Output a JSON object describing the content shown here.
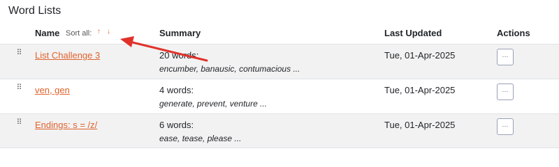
{
  "page": {
    "title": "Word Lists"
  },
  "header": {
    "name": "Name",
    "sort_all": "Sort all:",
    "sort_up": "↑",
    "sort_down": "↓",
    "summary": "Summary",
    "last_updated": "Last Updated",
    "actions": "Actions"
  },
  "rows": [
    {
      "name": "List Challenge 3",
      "count": "20 words:",
      "words": "encumber, banausic, contumacious ...",
      "updated": "Tue, 01-Apr-2025",
      "action": "···"
    },
    {
      "name": "ven, gen",
      "count": "4 words:",
      "words": "generate, prevent, venture ...",
      "updated": "Tue, 01-Apr-2025",
      "action": "···"
    },
    {
      "name": "Endings: s = /z/",
      "count": "6 words:",
      "words": "ease, tease, please ...",
      "updated": "Tue, 01-Apr-2025",
      "action": "···"
    }
  ],
  "colors": {
    "link": "#e0622d",
    "annotation_arrow": "#e0322a",
    "row_alt": "#f2f2f2"
  },
  "icons": {
    "drag_handle": "drag-handle-icon",
    "more": "more-icon"
  }
}
